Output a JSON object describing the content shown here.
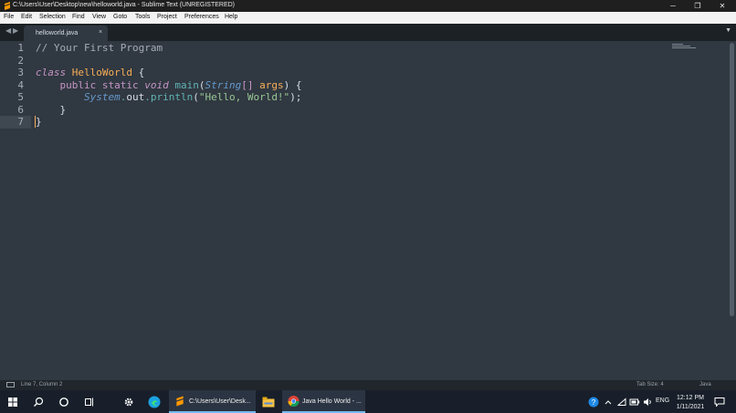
{
  "window": {
    "title": "C:\\Users\\User\\Desktop\\new\\helloworld.java - Sublime Text (UNREGISTERED)",
    "minimize_glyph": "─",
    "maximize_glyph": "❐",
    "close_glyph": "✕"
  },
  "menu": [
    "File",
    "Edit",
    "Selection",
    "Find",
    "View",
    "Goto",
    "Tools",
    "Project",
    "Preferences",
    "Help"
  ],
  "tabs": {
    "nav_back": "◀",
    "nav_forward": "▶",
    "active": "helloworld.java",
    "close_glyph": "×",
    "dropdown_glyph": "▼"
  },
  "editor": {
    "line_numbers": [
      "1",
      "2",
      "3",
      "4",
      "5",
      "6",
      "7"
    ],
    "current_line": "7",
    "code": {
      "l1": "// Your First Program",
      "l3_kw": "class",
      "l3_name": "HelloWorld",
      "l3_brace": " {",
      "l4_indent": "    ",
      "l4_public": "public",
      "l4_static": "static",
      "l4_void": "void",
      "l4_main": "main",
      "l4_paren": "(",
      "l4_type": "String",
      "l4_brackets": "[]",
      "l4_args": "args",
      "l4_close": ") {",
      "l5_indent": "        ",
      "l5_system": "System",
      "l5_dot1": ".",
      "l5_out": "out",
      "l5_dot2": ".",
      "l5_println": "println",
      "l5_paren": "(",
      "l5_string": "\"Hello, World!\"",
      "l5_end": ");",
      "l6": "    }",
      "l7": "}"
    }
  },
  "status": {
    "position": "Line 7, Column 2",
    "tab_size": "Tab Size: 4",
    "syntax": "Java"
  },
  "taskbar": {
    "sublime_task": "C:\\Users\\User\\Desk...",
    "chrome_task": "Java Hello World - ...",
    "language": "ENG",
    "time": "12:12 PM",
    "date": "1/11/2021"
  },
  "colors": {
    "editor_bg": "#303841",
    "keyword": "#c695c6",
    "class_name": "#f9ae58",
    "function": "#5fb4b4",
    "type": "#6699cc",
    "string": "#99c794",
    "comment": "#a6acb9",
    "taskbar_bg": "#181f2a"
  },
  "icons": [
    "sublime-icon",
    "windows-start-icon",
    "search-icon",
    "cortana-icon",
    "task-view-icon",
    "settings-icon",
    "edge-icon",
    "file-explorer-icon",
    "chrome-icon",
    "help-icon",
    "tray-chevron-icon",
    "network-icon",
    "battery-icon",
    "volume-icon",
    "notifications-icon"
  ]
}
